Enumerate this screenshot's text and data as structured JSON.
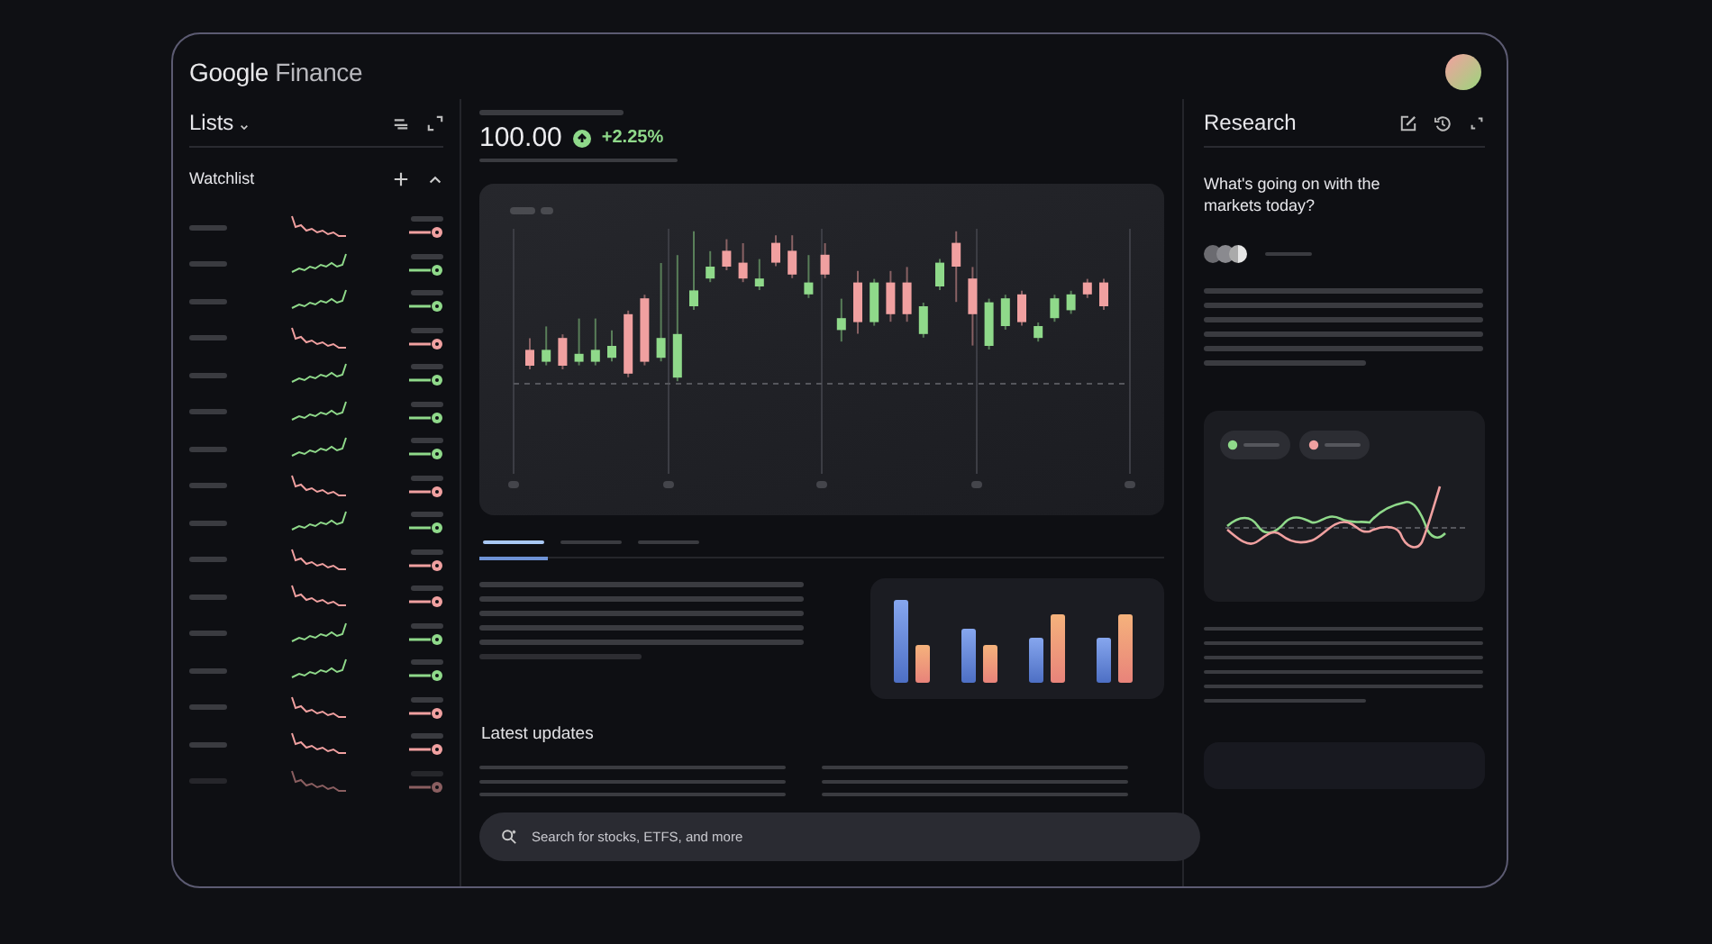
{
  "header": {
    "logo": {
      "brand": "Google",
      "product": "Finance"
    }
  },
  "lists": {
    "title": "Lists",
    "section": "Watchlist",
    "items": [
      {
        "kind": "down"
      },
      {
        "kind": "up"
      },
      {
        "kind": "up"
      },
      {
        "kind": "down"
      },
      {
        "kind": "up"
      },
      {
        "kind": "up"
      },
      {
        "kind": "up"
      },
      {
        "kind": "down"
      },
      {
        "kind": "up"
      },
      {
        "kind": "down"
      },
      {
        "kind": "down"
      },
      {
        "kind": "up"
      },
      {
        "kind": "up"
      },
      {
        "kind": "down"
      },
      {
        "kind": "down"
      },
      {
        "kind": "down"
      }
    ]
  },
  "quote": {
    "price": "100.00",
    "change": "+2.25%",
    "kind": "up"
  },
  "tabs": [
    {
      "selected": true
    },
    {
      "selected": false
    },
    {
      "selected": false
    }
  ],
  "latest": {
    "title": "Latest updates"
  },
  "search": {
    "placeholder": "Search for stocks, ETFS, and more"
  },
  "research": {
    "title": "Research",
    "question": "What's going on with the markets today?"
  }
}
